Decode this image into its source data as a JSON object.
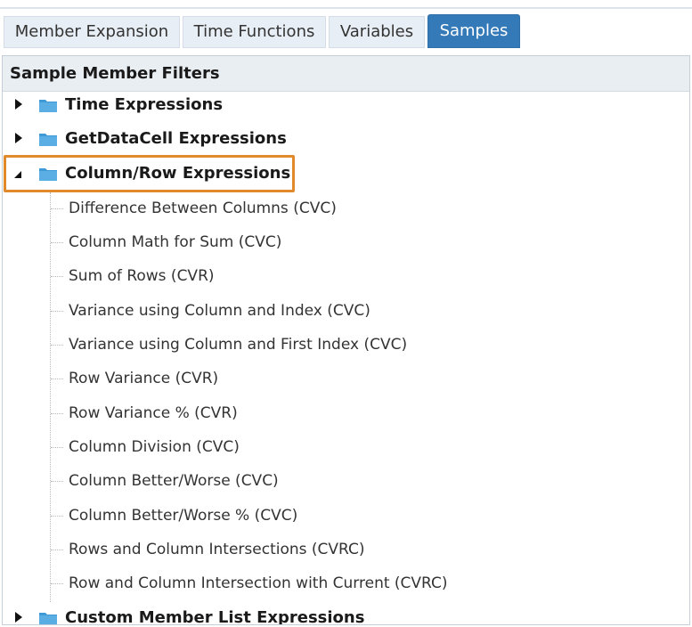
{
  "tabs": [
    {
      "label": "Member Expansion",
      "active": false
    },
    {
      "label": "Time Functions",
      "active": false
    },
    {
      "label": "Variables",
      "active": false
    },
    {
      "label": "Samples",
      "active": true
    }
  ],
  "panel": {
    "header": "Sample Member Filters"
  },
  "tree": {
    "folders": [
      {
        "label": "Time Expressions",
        "expanded": false
      },
      {
        "label": "GetDataCell Expressions",
        "expanded": false
      },
      {
        "label": "Column/Row Expressions",
        "expanded": true,
        "highlighted": true
      },
      {
        "label": "Custom Member List Expressions",
        "expanded": false
      }
    ],
    "children": [
      "Difference Between Columns (CVC)",
      "Column Math for Sum (CVC)",
      "Sum of Rows (CVR)",
      "Variance using Column and Index (CVC)",
      "Variance using Column and First Index (CVC)",
      "Row Variance (CVR)",
      "Row Variance % (CVR)",
      "Column Division (CVC)",
      "Column Better/Worse (CVC)",
      "Column Better/Worse % (CVC)",
      "Rows and Column Intersections (CVRC)",
      "Row and Column Intersection with Current (CVRC)"
    ]
  },
  "colors": {
    "active_tab": "#3479b8",
    "inactive_tab": "#e8eef5",
    "header_bg": "#e9eef3",
    "folder_icon": "#3d9ad6",
    "highlight": "#e08a2c"
  },
  "icons": {
    "folder": "folder-icon",
    "collapsed": "triangle-right-icon",
    "expanded": "triangle-down-icon"
  }
}
